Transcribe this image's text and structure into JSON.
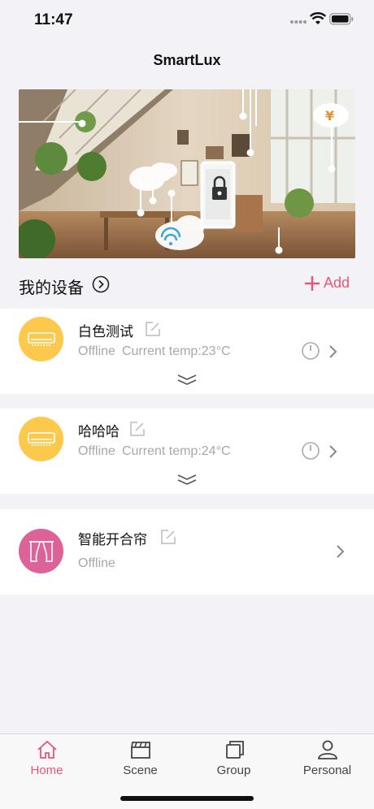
{
  "status_bar": {
    "time": "11:47"
  },
  "header": {
    "title": "SmartLux"
  },
  "section": {
    "title": "我的设备",
    "add_label": "Add"
  },
  "devices": [
    {
      "name": "白色测试",
      "status": "Offline",
      "temp": "Current temp:23°C",
      "icon": "air-conditioner-icon"
    },
    {
      "name": "哈哈哈",
      "status": "Offline",
      "temp": "Current temp:24°C",
      "icon": "air-conditioner-icon"
    },
    {
      "name": "智能开合帘",
      "status": "Offline",
      "icon": "curtain-icon"
    }
  ],
  "tabs": [
    {
      "label": "Home",
      "icon": "home-icon",
      "active": true
    },
    {
      "label": "Scene",
      "icon": "clapperboard-icon",
      "active": false
    },
    {
      "label": "Group",
      "icon": "group-icon",
      "active": false
    },
    {
      "label": "Personal",
      "icon": "person-icon",
      "active": false
    }
  ],
  "colors": {
    "accent": "#e8557a",
    "device_yellow": "#fcc94c",
    "device_pink": "#dd6298"
  }
}
